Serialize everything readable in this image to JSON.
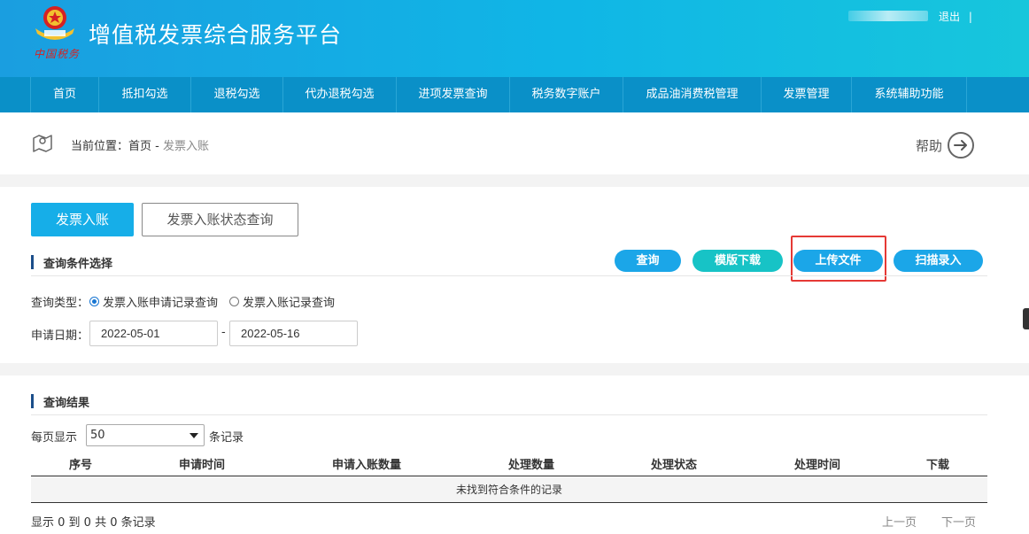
{
  "header": {
    "title": "增值税发票综合服务平台",
    "brand_sub": "中国税务",
    "logout_label": "退出",
    "logout_sep": "|"
  },
  "nav": {
    "items": [
      {
        "label": "首页"
      },
      {
        "label": "抵扣勾选"
      },
      {
        "label": "退税勾选"
      },
      {
        "label": "代办退税勾选"
      },
      {
        "label": "进项发票查询"
      },
      {
        "label": "税务数字账户"
      },
      {
        "label": "成品油消费税管理"
      },
      {
        "label": "发票管理"
      },
      {
        "label": "系统辅助功能"
      }
    ]
  },
  "breadcrumb": {
    "prefix": "当前位置：",
    "home": "首页",
    "sep": " - ",
    "current": "发票入账"
  },
  "help_label": "帮助",
  "tabs": {
    "active": "发票入账",
    "other": "发票入账状态查询"
  },
  "query": {
    "section_title": "查询条件选择",
    "buttons": {
      "search": "查询",
      "template": "模版下载",
      "upload": "上传文件",
      "scan": "扫描录入"
    },
    "type_label": "查询类型：",
    "type_option_1": "发票入账申请记录查询",
    "type_option_2": "发票入账记录查询",
    "date_label": "申请日期：",
    "date_from": "2022-05-01",
    "date_sep": "-",
    "date_to": "2022-05-16"
  },
  "results": {
    "section_title": "查询结果",
    "per_page_label": "每页显示",
    "per_page_value": "50",
    "per_page_unit": "条记录",
    "columns": [
      "序号",
      "申请时间",
      "申请入账数量",
      "处理数量",
      "处理状态",
      "处理时间",
      "下载"
    ],
    "empty_text": "未找到符合条件的记录",
    "summary": "显示 0 到 0 共 0 条记录",
    "prev": "上一页",
    "next": "下一页"
  },
  "colors": {
    "accent": "#16aee8",
    "teal": "#17c3c6",
    "highlight": "#e53935",
    "nav_bg": "#0a90c8"
  }
}
